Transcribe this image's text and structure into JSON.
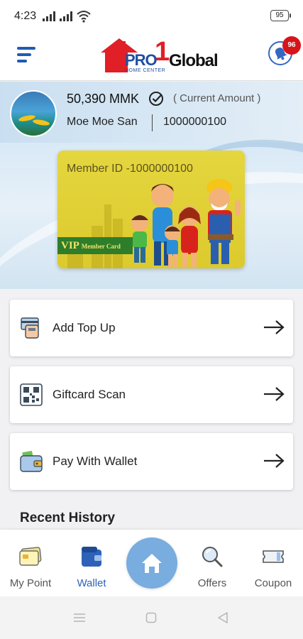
{
  "status_bar": {
    "time": "4:23",
    "battery": "95"
  },
  "header": {
    "logo_pro": "PRO",
    "logo_one": "1",
    "logo_home_center": "HOME CENTER",
    "logo_global": "Global",
    "notification_count": "96"
  },
  "account": {
    "amount": "50,390 MMK",
    "amount_note": "( Current Amount )",
    "name": "Moe Moe San",
    "member_number": "1000000100"
  },
  "vip_card": {
    "member_id": "Member ID -1000000100",
    "tag_main": "VIP",
    "tag_sub": "Member Card"
  },
  "actions": [
    {
      "label": "Add Top Up",
      "icon": "top-up-icon"
    },
    {
      "label": "Giftcard Scan",
      "icon": "qr-code-icon"
    },
    {
      "label": "Pay With Wallet",
      "icon": "wallet-icon"
    }
  ],
  "recent_history": {
    "title": "Recent History"
  },
  "bottom_nav": {
    "items": [
      {
        "label": "My Point",
        "icon": "point-card-icon"
      },
      {
        "label": "Wallet",
        "icon": "wallet-icon",
        "active": true
      },
      {
        "label": "",
        "icon": "home-icon"
      },
      {
        "label": "Offers",
        "icon": "search-icon"
      },
      {
        "label": "Coupon",
        "icon": "ticket-icon"
      }
    ]
  },
  "colors": {
    "brand_blue": "#1f5bb5",
    "brand_red": "#e01f26",
    "active_nav": "#2d62b8",
    "home_button": "#79acdf",
    "card_yellow": "#e0cf36"
  }
}
